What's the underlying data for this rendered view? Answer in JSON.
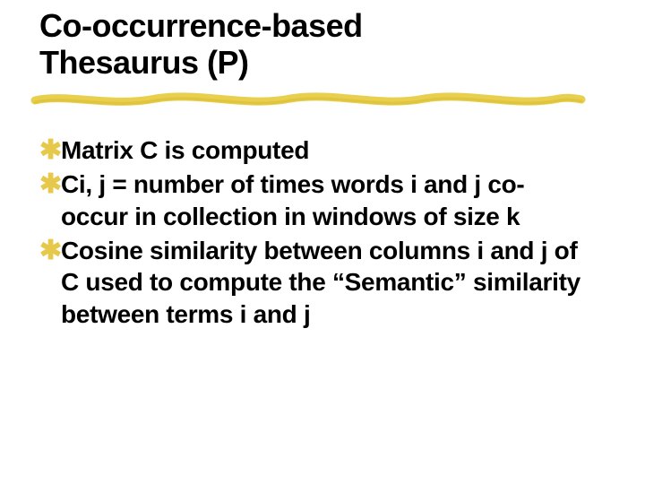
{
  "title_line1": "Co-occurrence-based",
  "title_line2": "Thesaurus (P)",
  "bullets": {
    "b0": "Matrix C is computed",
    "b1": "Ci, j = number of times words i and j co-occur in  collection in windows of  size k",
    "b2": "Cosine similarity between columns i and j of C used to compute the “Semantic” similarity  between terms i and j"
  }
}
